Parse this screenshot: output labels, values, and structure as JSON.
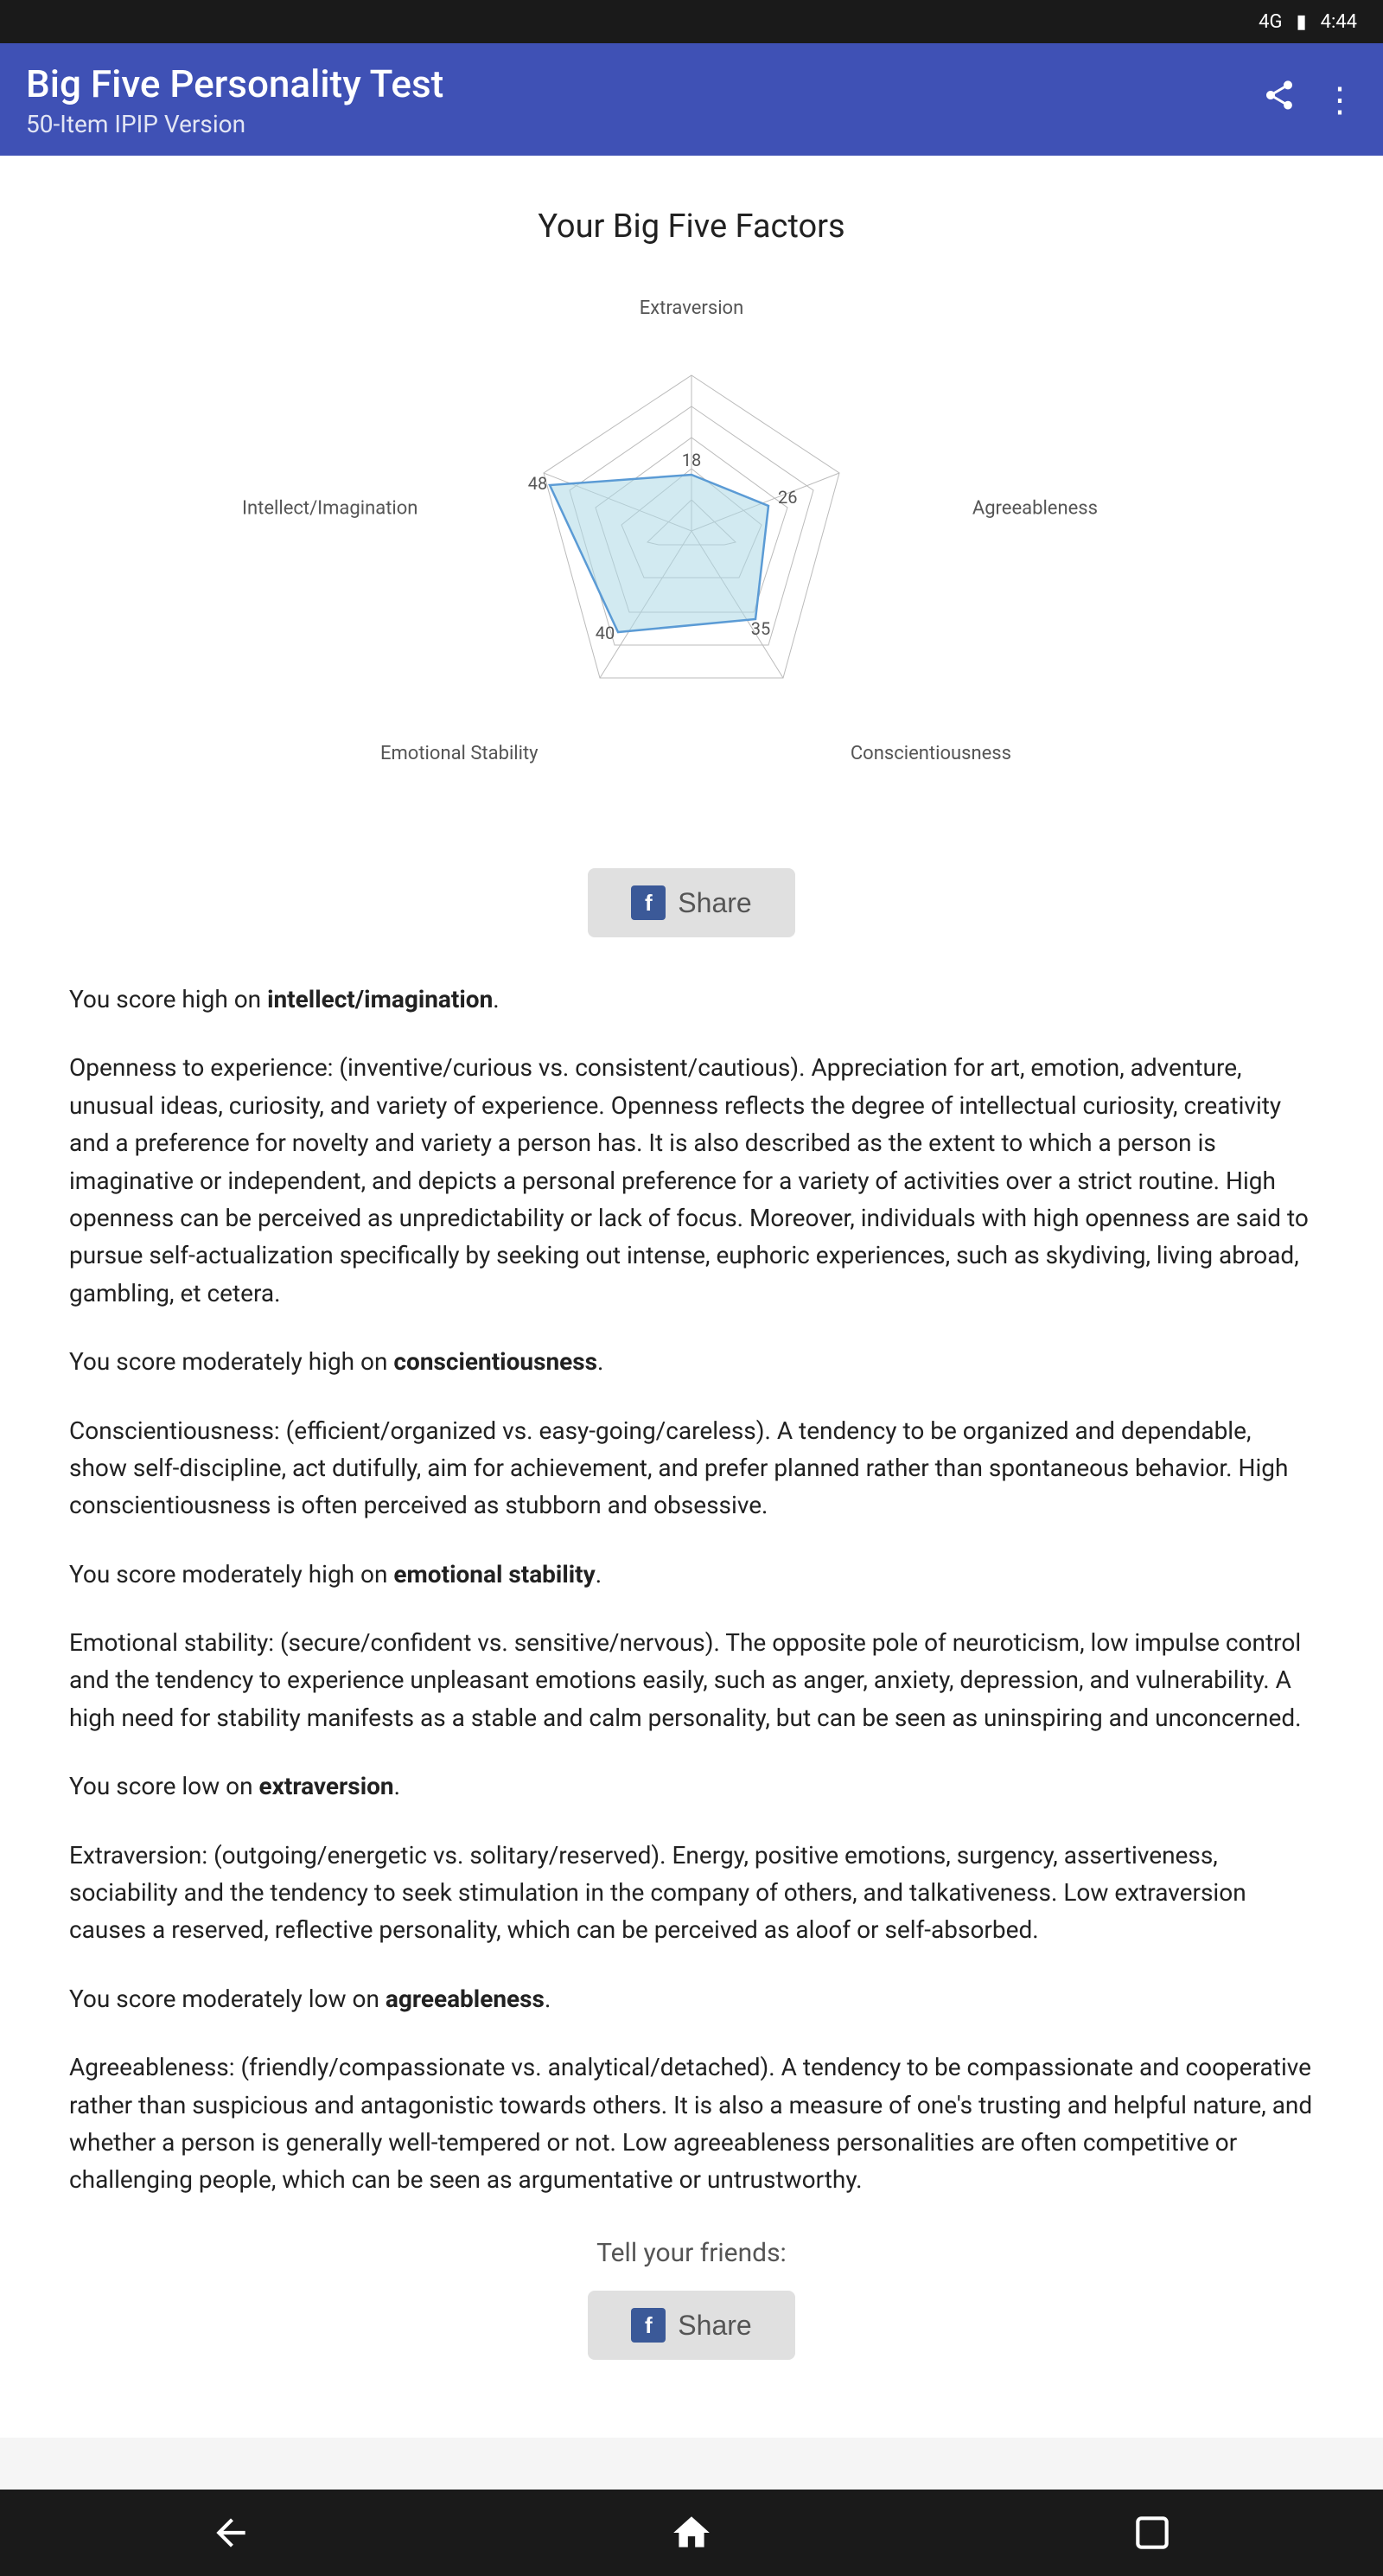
{
  "statusBar": {
    "signal": "4G",
    "battery": "🔋",
    "time": "4:44"
  },
  "appBar": {
    "title": "Big Five Personality Test",
    "subtitle": "50-Item IPIP Version",
    "shareIconLabel": "share",
    "menuIconLabel": "more options"
  },
  "chart": {
    "title": "Your Big Five Factors",
    "labels": {
      "top": "Extraversion",
      "right": "Agreeableness",
      "bottomRight": "Conscientiousness",
      "bottomLeft": "Emotional Stability",
      "left": "Intellect/Imagination"
    },
    "values": {
      "extraversion": 18,
      "agreeableness": 26,
      "conscientiousness": 35,
      "emotionalStability": 40,
      "intellect": 48
    }
  },
  "shareButton": {
    "label": "Share"
  },
  "descriptions": [
    {
      "id": "intellect-intro",
      "text1": "You score high on ",
      "bold": "intellect/imagination",
      "text2": "."
    },
    {
      "id": "intellect-desc",
      "text": "Openness to experience: (inventive/curious vs. consistent/cautious). Appreciation for art, emotion, adventure, unusual ideas, curiosity, and variety of experience. Openness reflects the degree of intellectual curiosity, creativity and a preference for novelty and variety a person has. It is also described as the extent to which a person is imaginative or independent, and depicts a personal preference for a variety of activities over a strict routine. High openness can be perceived as unpredictability or lack of focus. Moreover, individuals with high openness are said to pursue self-actualization specifically by seeking out intense, euphoric experiences, such as skydiving, living abroad, gambling, et cetera."
    },
    {
      "id": "conscientiousness-intro",
      "text1": "You score moderately high on ",
      "bold": "conscientiousness",
      "text2": "."
    },
    {
      "id": "conscientiousness-desc",
      "text": "Conscientiousness: (efficient/organized vs. easy-going/careless). A tendency to be organized and dependable, show self-discipline, act dutifully, aim for achievement, and prefer planned rather than spontaneous behavior. High conscientiousness is often perceived as stubborn and obsessive."
    },
    {
      "id": "emotional-intro",
      "text1": "You score moderately high on ",
      "bold": "emotional stability",
      "text2": "."
    },
    {
      "id": "emotional-desc",
      "text": "Emotional stability: (secure/confident vs. sensitive/nervous). The opposite pole of neuroticism, low impulse control and the tendency to experience unpleasant emotions easily, such as anger, anxiety, depression, and vulnerability. A high need for stability manifests as a stable and calm personality, but can be seen as uninspiring and unconcerned."
    },
    {
      "id": "extraversion-intro",
      "text1": "You score low on ",
      "bold": "extraversion",
      "text2": "."
    },
    {
      "id": "extraversion-desc",
      "text": "Extraversion: (outgoing/energetic vs. solitary/reserved). Energy, positive emotions, surgency, assertiveness, sociability and the tendency to seek stimulation in the company of others, and talkativeness. Low extraversion causes a reserved, reflective personality, which can be perceived as aloof or self-absorbed."
    },
    {
      "id": "agreeableness-intro",
      "text1": "You score moderately low on ",
      "bold": "agreeableness",
      "text2": "."
    },
    {
      "id": "agreeableness-desc",
      "text": "Agreeableness: (friendly/compassionate vs. analytical/detached). A tendency to be compassionate and cooperative rather than suspicious and antagonistic towards others. It is also a measure of one's trusting and helpful nature, and whether a person is generally well-tempered or not. Low agreeableness personalities are often competitive or challenging people, which can be seen as argumentative or untrustworthy."
    }
  ],
  "footer": {
    "tellFriends": "Tell your friends:",
    "shareLabel": "Share"
  },
  "navBar": {
    "back": "←",
    "home": "⌂",
    "recents": "▭"
  }
}
